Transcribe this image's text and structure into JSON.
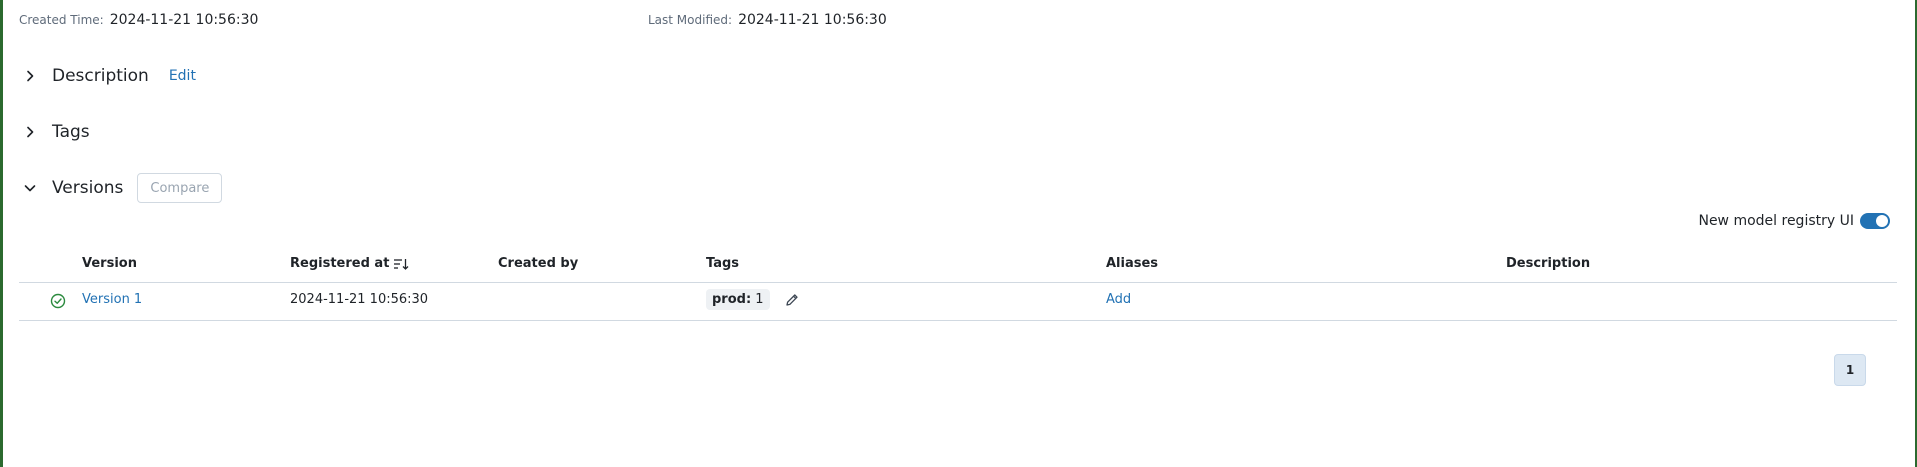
{
  "meta": {
    "created_label": "Created Time:",
    "created_value": "2024-11-21 10:56:30",
    "modified_label": "Last Modified:",
    "modified_value": "2024-11-21 10:56:30"
  },
  "sections": {
    "description": {
      "title": "Description",
      "edit_label": "Edit",
      "expanded": false
    },
    "tags": {
      "title": "Tags",
      "expanded": false
    },
    "versions": {
      "title": "Versions",
      "compare_label": "Compare",
      "expanded": true
    }
  },
  "toggle": {
    "label": "New model registry UI",
    "on": true
  },
  "table": {
    "columns": {
      "version": "Version",
      "registered_at": "Registered at",
      "created_by": "Created by",
      "tags": "Tags",
      "aliases": "Aliases",
      "description": "Description"
    },
    "rows": [
      {
        "status": "ready",
        "version": "Version 1",
        "registered_at": "2024-11-21 10:56:30",
        "created_by": "",
        "tag_key": "prod:",
        "tag_value": "1",
        "aliases_action": "Add",
        "description": ""
      }
    ]
  },
  "pagination": {
    "current_page": "1"
  },
  "colors": {
    "accent": "#2272b4",
    "success": "#2b8a3e",
    "frame": "#2b6a2f"
  },
  "icons": {
    "collapsed": "chevron-right-icon",
    "expanded": "chevron-down-icon",
    "sort": "sort-descending-icon",
    "status": "check-circle-icon",
    "edit": "pencil-icon"
  }
}
